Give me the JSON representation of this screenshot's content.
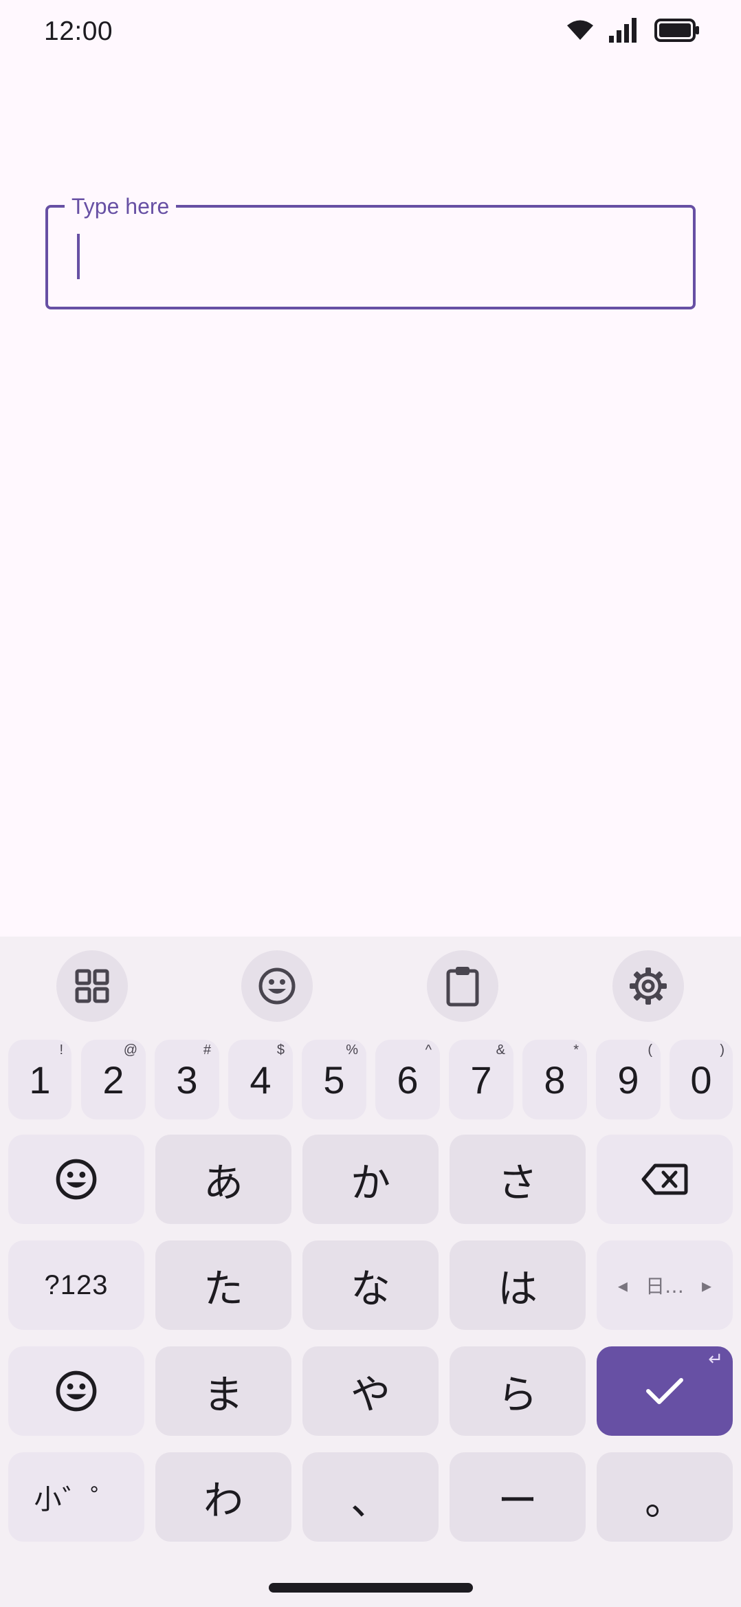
{
  "status_bar": {
    "time": "12:00",
    "icons": [
      "wifi-icon",
      "signal-icon",
      "battery-icon"
    ]
  },
  "text_field": {
    "label": "Type here",
    "value": "",
    "accent_color": "#6750A4"
  },
  "keyboard": {
    "toolbar": [
      "grid-icon",
      "emoji-icon",
      "clipboard-icon",
      "settings-icon"
    ],
    "number_row": [
      {
        "main": "1",
        "sub": "!"
      },
      {
        "main": "2",
        "sub": "@"
      },
      {
        "main": "3",
        "sub": "#"
      },
      {
        "main": "4",
        "sub": "$"
      },
      {
        "main": "5",
        "sub": "%"
      },
      {
        "main": "6",
        "sub": "^"
      },
      {
        "main": "7",
        "sub": "&"
      },
      {
        "main": "8",
        "sub": "*"
      },
      {
        "main": "9",
        "sub": "("
      },
      {
        "main": "0",
        "sub": ")"
      }
    ],
    "kana": {
      "a": "あ",
      "ka": "か",
      "sa": "さ",
      "ta": "た",
      "na": "な",
      "ha": "は",
      "ma": "ま",
      "ya": "や",
      "ra": "ら",
      "wa": "わ",
      "comma": "、",
      "dash": "ー",
      "period": "。"
    },
    "symbols_label": "?123",
    "small_kana_label": "小゛゜",
    "language_label": "日…",
    "enter_sub": "↵"
  }
}
